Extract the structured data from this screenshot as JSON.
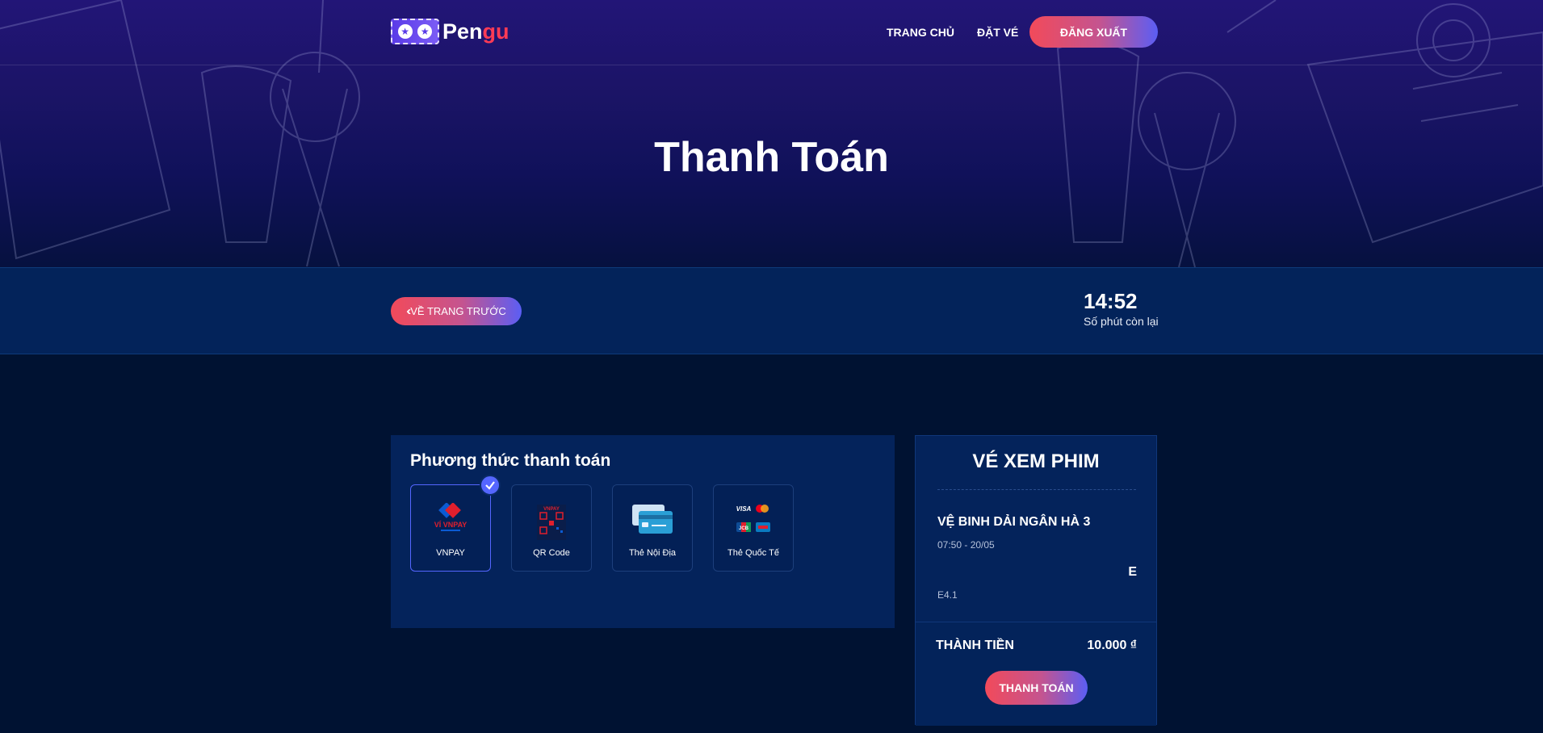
{
  "header": {
    "logo_left": "Pen",
    "logo_right": "gu",
    "nav": [
      "TRANG CHỦ",
      "ĐẶT VÉ"
    ],
    "logout_label": "ĐĂNG XUẤT"
  },
  "hero": {
    "title": "Thanh Toán"
  },
  "bar": {
    "back_label": "VỀ TRANG TRƯỚC",
    "timer_value": "14:52",
    "timer_label": "Số phút còn lại"
  },
  "payment": {
    "title": "Phương thức thanh toán",
    "methods": [
      {
        "label": "VNPAY",
        "icon": "vnpay-icon",
        "selected": true
      },
      {
        "label": "QR Code",
        "icon": "qr-code-icon",
        "selected": false
      },
      {
        "label": "Thẻ Nội Địa",
        "icon": "domestic-card-icon",
        "selected": false
      },
      {
        "label": "Thẻ Quốc Tế",
        "icon": "international-card-icon",
        "selected": false
      }
    ]
  },
  "ticket": {
    "title": "VÉ XEM PHIM",
    "movie": "VỆ BINH DẢI NGÂN HÀ 3",
    "showtime": "07:50 - 20/05",
    "seat_row": "E",
    "seat_code": "E4.1",
    "total_label": "THÀNH TIỀN",
    "total_value": "10.000 ₫",
    "pay_label": "THANH TOÁN"
  },
  "colors": {
    "background": "#001232",
    "panel": "#04235b",
    "accent_start": "#f24a5a",
    "accent_end": "#5b5ef4",
    "logo_accent": "#ff3b55",
    "selected_border": "#5466ff"
  }
}
